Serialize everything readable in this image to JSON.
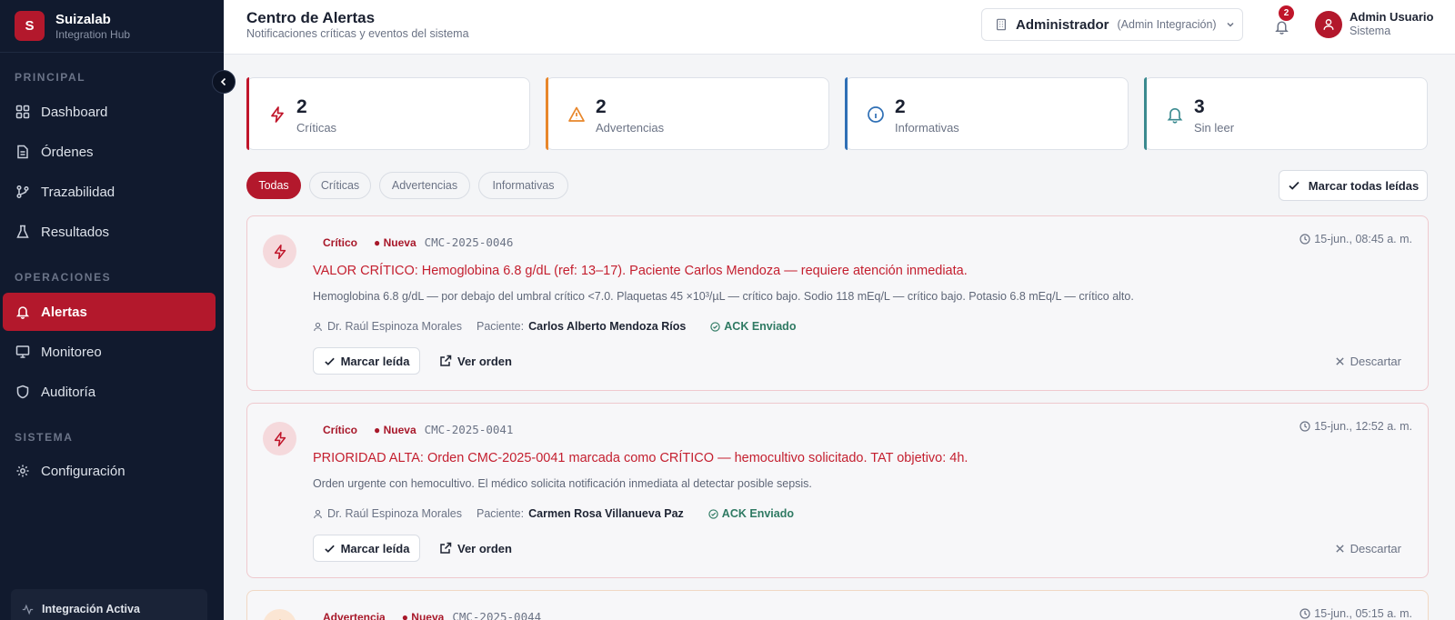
{
  "brand": {
    "logo_letter": "S",
    "name": "Suizalab",
    "subtitle": "Integration Hub"
  },
  "sidebar": {
    "sections": [
      {
        "label": "PRINCIPAL",
        "items": [
          "Dashboard",
          "Órdenes",
          "Trazabilidad",
          "Resultados"
        ]
      },
      {
        "label": "OPERACIONES",
        "items": [
          "Alertas",
          "Monitoreo",
          "Auditoría"
        ]
      },
      {
        "label": "SISTEMA",
        "items": [
          "Configuración"
        ]
      }
    ],
    "active_item": "Alertas",
    "integration_status": "Integración Activa"
  },
  "header": {
    "title": "Centro de Alertas",
    "subtitle": "Notificaciones críticas y eventos del sistema",
    "role_name": "Administrador",
    "role_detail": "(Admin Integración)",
    "notification_count": "2",
    "user_name": "Admin Usuario",
    "user_role": "Sistema"
  },
  "stats": [
    {
      "value": "2",
      "label": "Críticas",
      "color": "#c0152a",
      "icon": "zap-icon"
    },
    {
      "value": "2",
      "label": "Advertencias",
      "color": "#e8862a",
      "icon": "warning-icon"
    },
    {
      "value": "2",
      "label": "Informativas",
      "color": "#2f6fb5",
      "icon": "info-icon"
    },
    {
      "value": "3",
      "label": "Sin leer",
      "color": "#3a8a8f",
      "icon": "bell-icon"
    }
  ],
  "filters": [
    "Todas",
    "Críticas",
    "Advertencias",
    "Informativas"
  ],
  "active_filter": "Todas",
  "mark_all_label": "Marcar todas leídas",
  "alerts": [
    {
      "severity": "Crítico",
      "status": "● Nueva",
      "code": "CMC-2025-0046",
      "time": "15-jun., 08:45 a. m.",
      "title": "VALOR CRÍTICO: Hemoglobina 6.8 g/dL (ref: 13–17). Paciente Carlos Mendoza — requiere atención inmediata.",
      "description": "Hemoglobina 6.8 g/dL — por debajo del umbral crítico <7.0. Plaquetas 45 ×10³/µL — crítico bajo. Sodio 118 mEq/L — crítico bajo. Potasio 6.8 mEq/L — crítico alto.",
      "doctor": "Dr. Raúl Espinoza Morales",
      "patient_label": "Paciente:",
      "patient": "Carlos Alberto Mendoza Ríos",
      "ack": "ACK Enviado",
      "read_label": "Marcar leída",
      "order_label": "Ver orden",
      "dismiss_label": "Descartar"
    },
    {
      "severity": "Crítico",
      "status": "● Nueva",
      "code": "CMC-2025-0041",
      "time": "15-jun., 12:52 a. m.",
      "title": "PRIORIDAD ALTA: Orden CMC-2025-0041 marcada como CRÍTICO — hemocultivo solicitado. TAT objetivo: 4h.",
      "description": "Orden urgente con hemocultivo. El médico solicita notificación inmediata al detectar posible sepsis.",
      "doctor": "Dr. Raúl Espinoza Morales",
      "patient_label": "Paciente:",
      "patient": "Carmen Rosa Villanueva Paz",
      "ack": "ACK Enviado",
      "read_label": "Marcar leída",
      "order_label": "Ver orden",
      "dismiss_label": "Descartar"
    },
    {
      "severity": "Advertencia",
      "status": "● Nueva",
      "code": "CMC-2025-0044",
      "time": "15-jun., 05:15 a. m."
    }
  ]
}
